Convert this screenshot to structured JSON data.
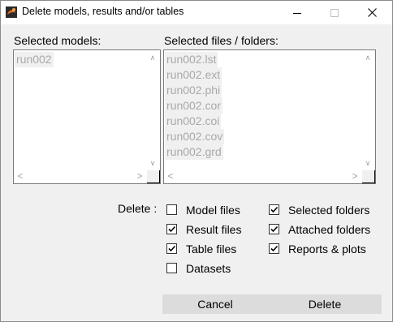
{
  "window": {
    "title": "Delete models, results and/or tables",
    "icon": "app-logo-icon",
    "controls": [
      "minimize-icon",
      "maximize-icon",
      "close-icon"
    ]
  },
  "models": {
    "label": "Selected models:",
    "items": [
      "run002"
    ]
  },
  "files": {
    "label": "Selected files / folders:",
    "items": [
      "run002.lst",
      "run002.ext",
      "run002.phi",
      "run002.cor",
      "run002.coi",
      "run002.cov",
      "run002.grd"
    ]
  },
  "delete": {
    "label": "Delete :",
    "options": {
      "model_files": {
        "label": "Model files",
        "checked": false
      },
      "result_files": {
        "label": "Result files",
        "checked": true
      },
      "table_files": {
        "label": "Table files",
        "checked": true
      },
      "datasets": {
        "label": "Datasets",
        "checked": false
      },
      "selected_folders": {
        "label": "Selected folders",
        "checked": true
      },
      "attached_folders": {
        "label": "Attached folders",
        "checked": true
      },
      "reports_plots": {
        "label": "Reports & plots",
        "checked": true
      }
    }
  },
  "buttons": {
    "cancel": "Cancel",
    "delete": "Delete"
  },
  "colors": {
    "accent": "#e07020",
    "window_bg": "#f0f0f0",
    "disabled_text": "#a8a8a8"
  }
}
